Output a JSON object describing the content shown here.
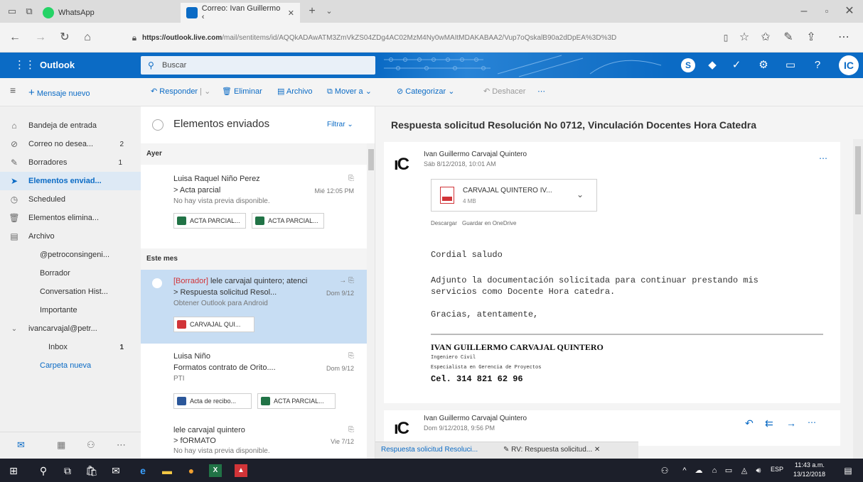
{
  "browser": {
    "tabs": [
      {
        "label": "WhatsApp"
      },
      {
        "label": "Correo: Ivan Guillermo ‹"
      }
    ],
    "url_domain": "https://outlook.live.com",
    "url_path": "/mail/sentitems/id/AQQkADAwATM3ZmVkZS04ZDg4AC02MzM4Ny0wMAItMDAKABAA2/Vup7oQskalB90a2dDpEA%3D%3D"
  },
  "outlook": {
    "brand": "Outlook",
    "search_placeholder": "Buscar",
    "avatar_initials": "IC"
  },
  "toolbar": {
    "new_message": "Mensaje nuevo",
    "reply": "Responder",
    "delete": "Eliminar",
    "archive": "Archivo",
    "move": "Mover a",
    "categorize": "Categorizar",
    "undo": "Deshacer"
  },
  "sidebar": {
    "items": [
      {
        "label": "Bandeja de entrada",
        "count": ""
      },
      {
        "label": "Correo no desea...",
        "count": "2"
      },
      {
        "label": "Borradores",
        "count": "1"
      },
      {
        "label": "Elementos enviad...",
        "count": ""
      },
      {
        "label": "Scheduled",
        "count": ""
      },
      {
        "label": "Elementos elimina...",
        "count": ""
      },
      {
        "label": "Archivo",
        "count": ""
      },
      {
        "label": "@petroconsingeni...",
        "count": ""
      },
      {
        "label": "Borrador",
        "count": ""
      },
      {
        "label": "Conversation Hist...",
        "count": ""
      },
      {
        "label": "Importante",
        "count": ""
      },
      {
        "label": "ivancarvajal@petr...",
        "count": ""
      },
      {
        "label": "Inbox",
        "count": "1"
      },
      {
        "label": "Carpeta nueva",
        "count": ""
      }
    ]
  },
  "message_list": {
    "title": "Elementos enviados",
    "filter": "Filtrar",
    "groups": [
      "Ayer",
      "Este mes"
    ],
    "messages": [
      {
        "from": "Luisa Raquel Niño Perez",
        "subject": "> Acta parcial",
        "date": "Mié 12:05 PM",
        "preview": "No hay vista previa disponible.",
        "chips": [
          "ACTA PARCIAL...",
          "ACTA PARCIAL..."
        ]
      },
      {
        "draft_tag": "[Borrador]",
        "from": "lele carvajal quintero; atenci",
        "subject": "> Respuesta solicitud Resol...",
        "date": "Dom 9/12",
        "preview": "Obtener Outlook para Android",
        "chips": [
          "CARVAJAL QUI..."
        ]
      },
      {
        "from": "Luisa Niño",
        "subject": "Formatos contrato de Orito....",
        "date": "Dom 9/12",
        "preview": "PTI",
        "chips": [
          "Acta de recibo...",
          "ACTA PARCIAL..."
        ]
      },
      {
        "from": "lele carvajal quintero",
        "subject": "> fORMATO",
        "date": "Vie 7/12",
        "preview": "No hay vista previa disponible."
      }
    ]
  },
  "reading": {
    "subject": "Respuesta solicitud Resolución No 0712, Vinculación Docentes Hora Catedra",
    "email1": {
      "sender": "Ivan Guillermo Carvajal Quintero",
      "date": "Sáb 8/12/2018, 10:01 AM",
      "attachment_name": "CARVAJAL QUINTERO IV...",
      "attachment_size": "4 MB",
      "download": "Descargar",
      "save_onedrive": "Guardar en OneDrive",
      "greeting": "Cordial saludo",
      "body_line1": "Adjunto la documentación solicitada para continuar prestando mis",
      "body_line2": "servicios como Docente Hora catedra.",
      "closing": "Gracias, atentamente,",
      "sig_name": "IVAN GUILLERMO CARVAJAL QUINTERO",
      "sig_title1": "Ingeniero Civil",
      "sig_title2": "Especialista en Gerencia de Proyectos",
      "sig_phone": "Cel. 314 821 62 96"
    },
    "email2": {
      "sender": "Ivan Guillermo Carvajal Quintero",
      "date": "Dom 9/12/2018, 9:56 PM"
    },
    "bottom_tabs": [
      "Respuesta solicitud Resoluci...",
      "RV: Respuesta solicitud..."
    ]
  },
  "taskbar": {
    "lang": "ESP",
    "time": "11:43 a.m.",
    "date": "13/12/2018"
  },
  "colors": {
    "accent": "#0b6bc5",
    "selected_row": "#c7ddf3",
    "draft_red": "#d13438"
  }
}
